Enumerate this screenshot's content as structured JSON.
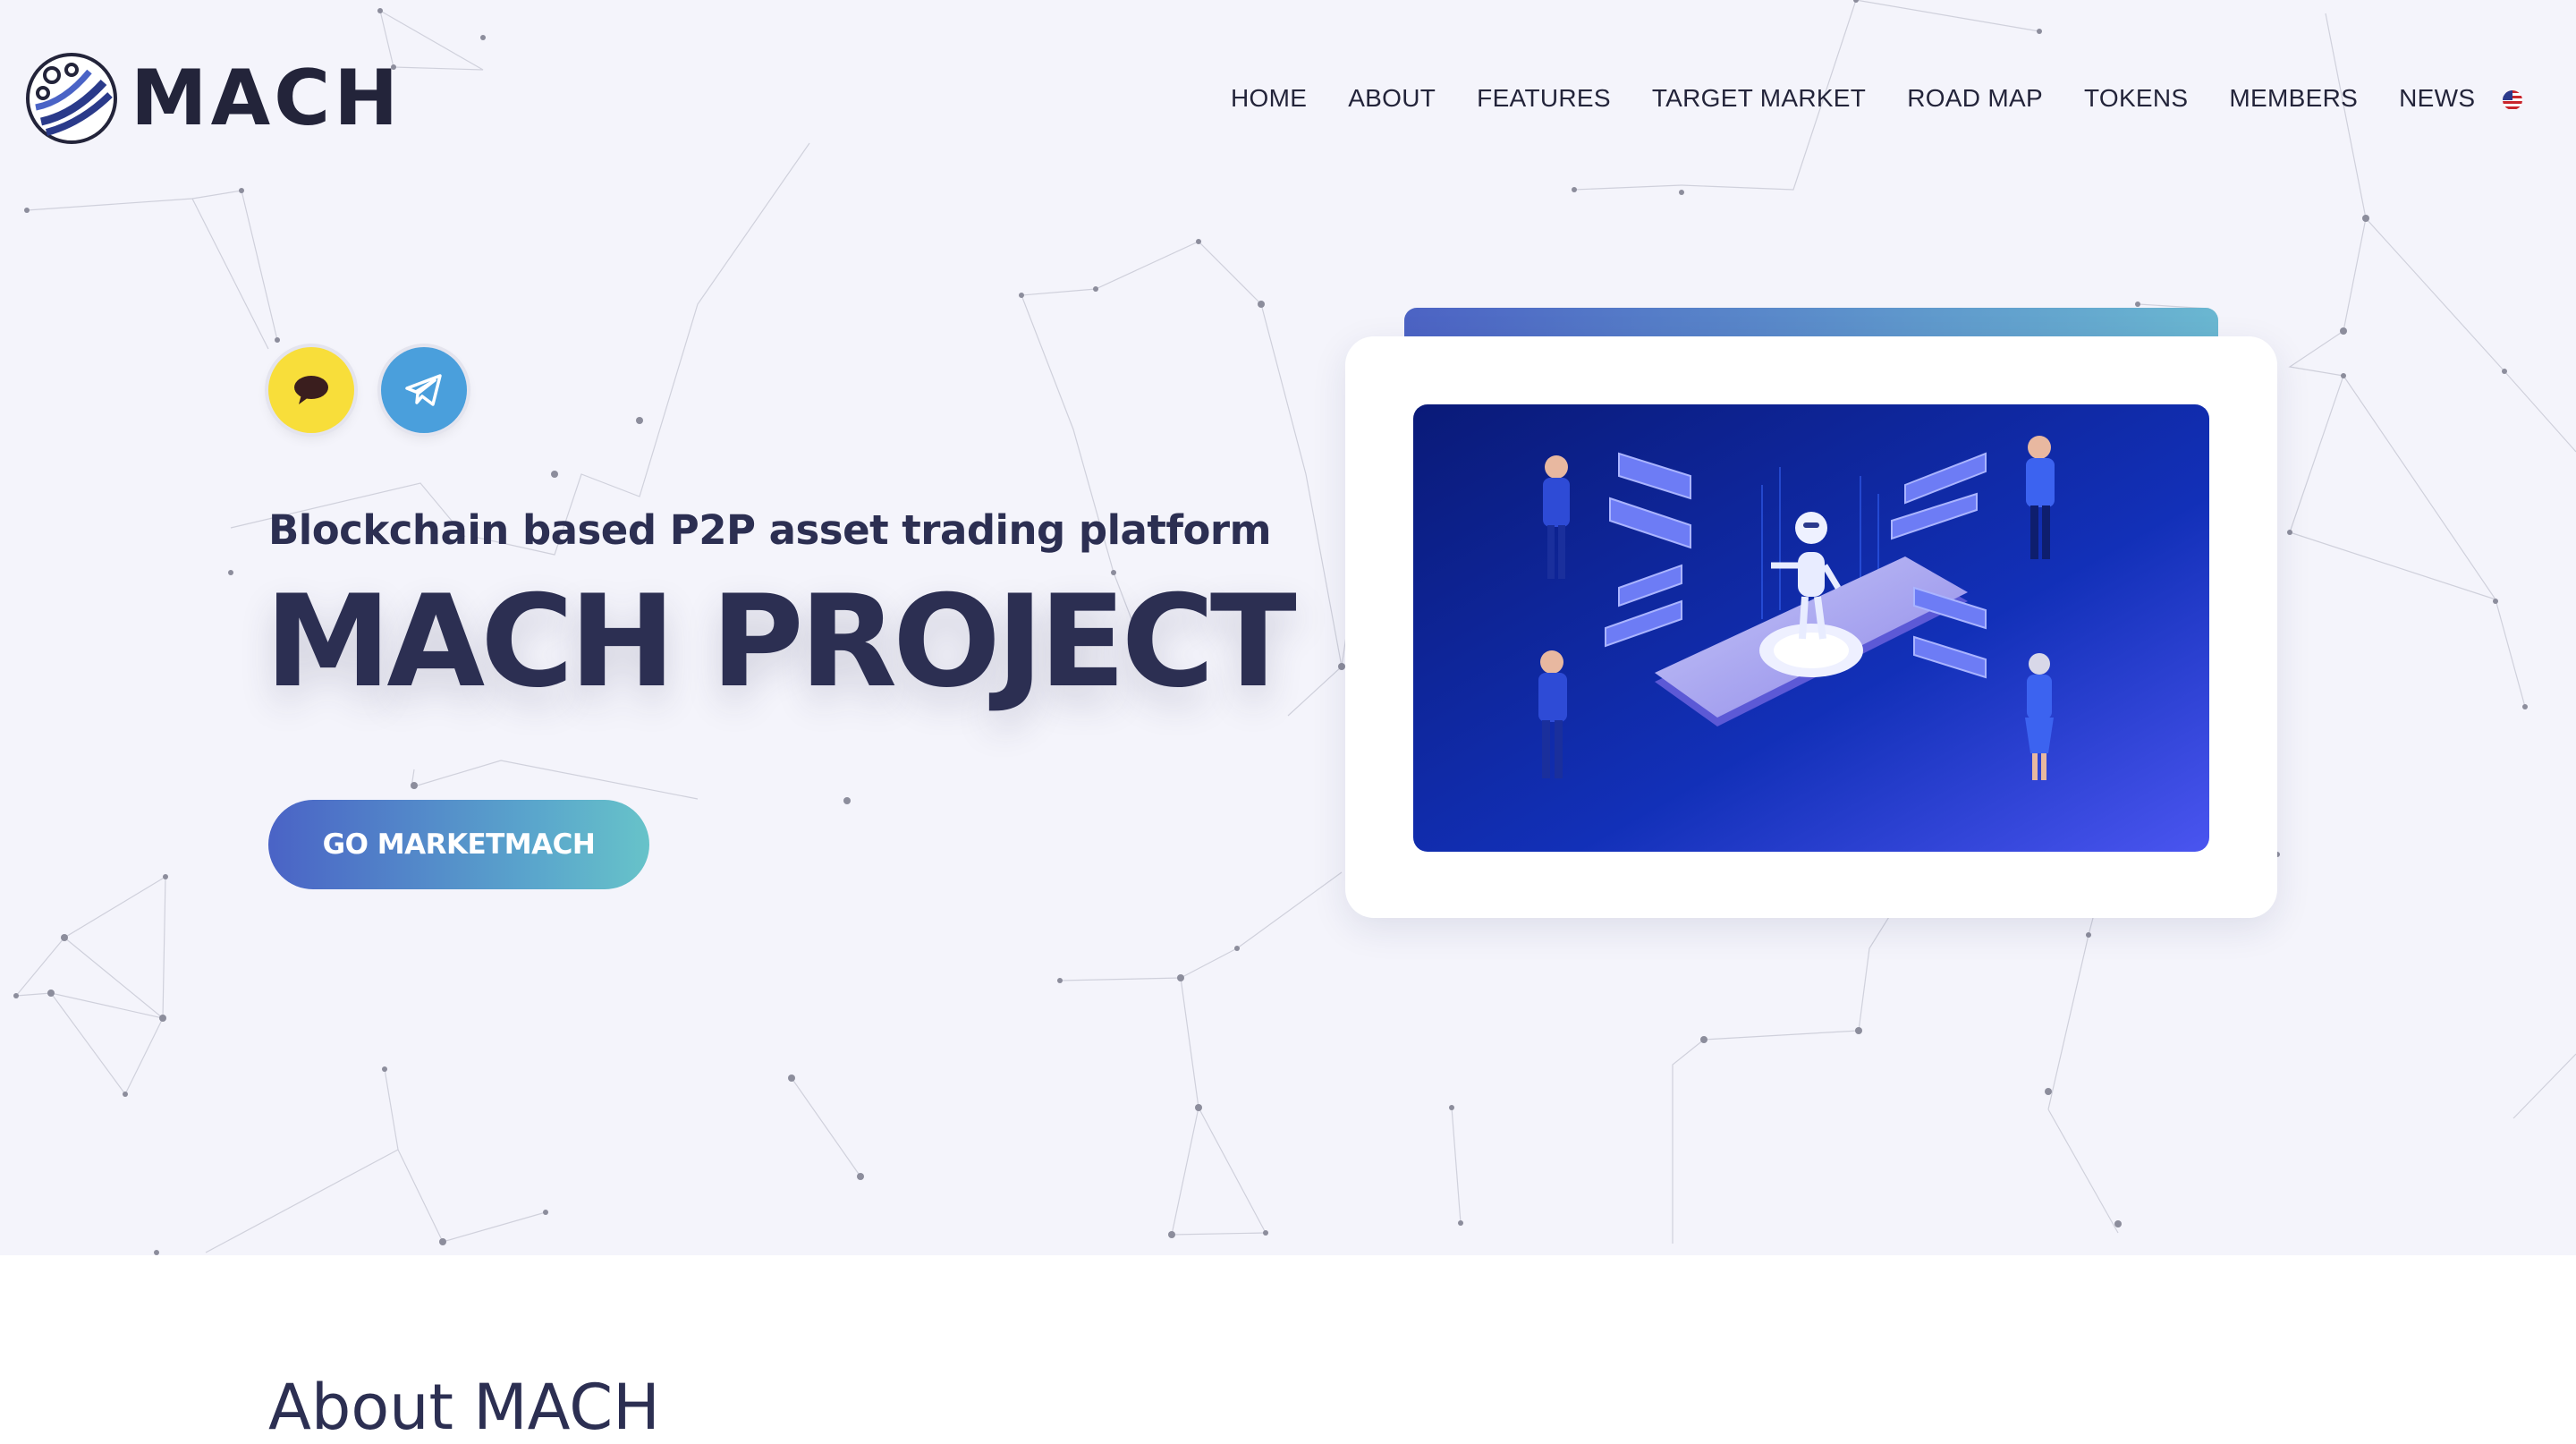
{
  "header": {
    "logo_text": "MACH",
    "language_flag": "us-flag"
  },
  "nav": {
    "items": [
      {
        "label": "HOME"
      },
      {
        "label": "ABOUT"
      },
      {
        "label": "FEATURES"
      },
      {
        "label": "TARGET MARKET"
      },
      {
        "label": "ROAD MAP"
      },
      {
        "label": "TOKENS"
      },
      {
        "label": "MEMBERS"
      },
      {
        "label": "NEWS"
      }
    ]
  },
  "social": {
    "kakao_icon": "kakao-chat-icon",
    "telegram_icon": "telegram-icon"
  },
  "hero": {
    "subtitle": "Blockchain based P2P asset trading platform",
    "title": "MACH PROJECT",
    "cta_label": "GO MARKETMACH",
    "illustration": "isometric robot on smartphone with people and chat bubbles"
  },
  "about": {
    "title": "About MACH"
  },
  "colors": {
    "hero_background": "#f4f4fb",
    "text_dark": "#2c2f52",
    "accent_blue": "#4a63c6",
    "accent_teal": "#67c3c9",
    "kakao_yellow": "#f8de3a",
    "telegram_blue": "#4a9fdc",
    "illustration_navy": "#0d1f8a"
  }
}
